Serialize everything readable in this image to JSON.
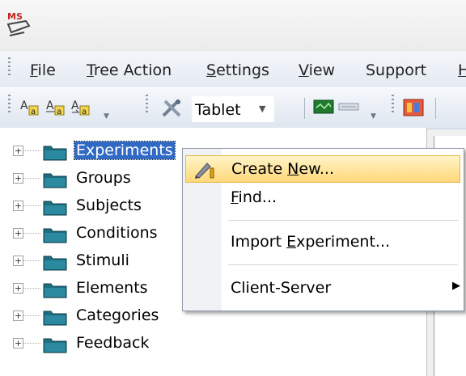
{
  "menubar": {
    "items": [
      {
        "label": "File",
        "mnemonic": "F",
        "rest": "ile"
      },
      {
        "label": "Tree Action",
        "mnemonic": "T",
        "rest": "ree Action"
      },
      {
        "label": "Settings",
        "mnemonic": "S",
        "rest": "ettings"
      },
      {
        "label": "View",
        "mnemonic": "V",
        "rest": "iew"
      },
      {
        "label": "Support",
        "mnemonic": "",
        "rest": "Support"
      },
      {
        "label": "H",
        "mnemonic": "H",
        "rest": ""
      }
    ]
  },
  "toolbar": {
    "device_combo": "Tablet"
  },
  "tree": {
    "items": [
      {
        "label": "Experiments",
        "selected": true
      },
      {
        "label": "Groups"
      },
      {
        "label": "Subjects"
      },
      {
        "label": "Conditions"
      },
      {
        "label": "Stimuli"
      },
      {
        "label": "Elements"
      },
      {
        "label": "Categories"
      },
      {
        "label": "Feedback"
      }
    ]
  },
  "context_menu": {
    "items": [
      {
        "pre": "Create ",
        "mn": "N",
        "post": "ew...",
        "highlighted": true,
        "icon": "pencil-icon"
      },
      {
        "pre": "",
        "mn": "F",
        "post": "ind..."
      },
      {
        "pre": "Import ",
        "mn": "E",
        "post": "xperiment..."
      },
      {
        "pre": "Client-Server",
        "mn": "",
        "post": "",
        "submenu": true
      }
    ]
  },
  "colors": {
    "selection": "#316ac5",
    "menu_highlight": "#ffd87a",
    "folder": "#1e6e80"
  }
}
